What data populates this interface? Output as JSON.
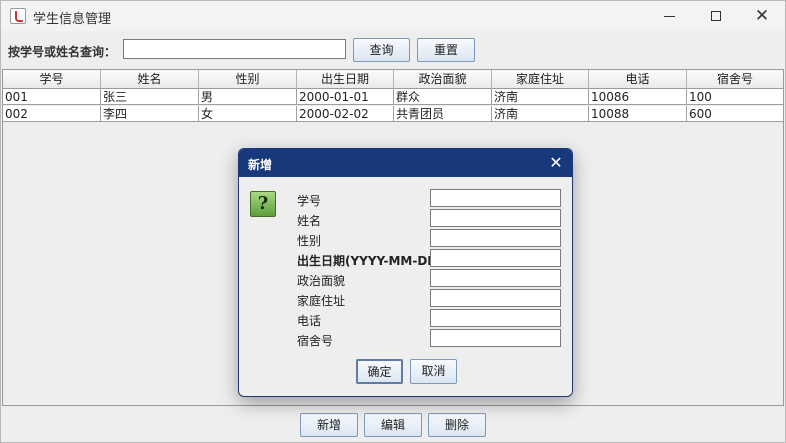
{
  "window": {
    "title": "学生信息管理",
    "controls": {
      "minimize": "—",
      "maximize": "□",
      "close": "✕"
    }
  },
  "search": {
    "label": "按学号或姓名查询：",
    "value": "",
    "search_button": "查询",
    "reset_button": "重置"
  },
  "table": {
    "columns": [
      "学号",
      "姓名",
      "性别",
      "出生日期",
      "政治面貌",
      "家庭住址",
      "电话",
      "宿舍号"
    ],
    "rows": [
      [
        "001",
        "张三",
        "男",
        "2000-01-01",
        "群众",
        "济南",
        "10086",
        "100"
      ],
      [
        "002",
        "李四",
        "女",
        "2000-02-02",
        "共青团员",
        "济南",
        "10088",
        "600"
      ]
    ]
  },
  "actions": {
    "add_button": "新增",
    "edit_button": "编辑",
    "delete_button": "删除"
  },
  "dialog": {
    "title": "新增",
    "close": "✕",
    "icon": "question-icon",
    "icon_glyph": "?",
    "fields": [
      {
        "label": "学号",
        "value": ""
      },
      {
        "label": "姓名",
        "value": ""
      },
      {
        "label": "性别",
        "value": ""
      },
      {
        "label": "出生日期(YYYY-MM-DD)",
        "value": ""
      },
      {
        "label": "政治面貌",
        "value": ""
      },
      {
        "label": "家庭住址",
        "value": ""
      },
      {
        "label": "电话",
        "value": ""
      },
      {
        "label": "宿舍号",
        "value": ""
      }
    ],
    "ok_button": "确定",
    "cancel_button": "取消"
  },
  "colors": {
    "dialog_titlebar": "#17397b",
    "button_border": "#7f9ab8",
    "question_icon": "#7bbf55"
  }
}
